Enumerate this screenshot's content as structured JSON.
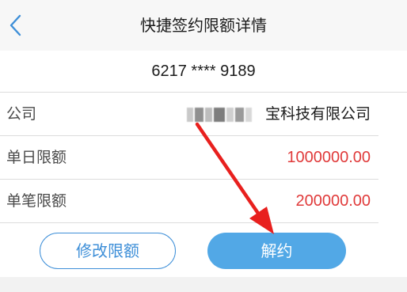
{
  "nav": {
    "title": "快捷签约限额详情",
    "back_icon": "chevron-left-icon"
  },
  "account": {
    "number": "6217 **** 9189"
  },
  "details": [
    {
      "label": "公司",
      "value": "宝科技有限公司"
    },
    {
      "label": "单日限额",
      "value": "1000000.00"
    },
    {
      "label": "单笔限额",
      "value": "200000.00"
    }
  ],
  "buttons": {
    "modify_label": "修改限额",
    "cancel_label": "解约"
  },
  "colors": {
    "accent": "#3e8fd8",
    "primary_button": "#52a8e6",
    "amount": "#e03a3a",
    "annotation_arrow": "#e8201e"
  }
}
